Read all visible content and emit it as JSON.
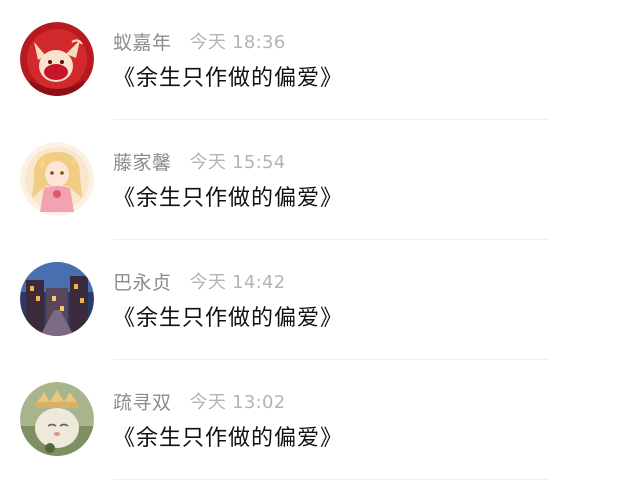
{
  "comments": [
    {
      "avatar_icon": "red-fox-avatar-icon",
      "name": "蚁嘉年",
      "time": "今天 18:36",
      "message": "《余生只作做的偏爱》"
    },
    {
      "avatar_icon": "golden-girl-avatar-icon",
      "name": "藤家馨",
      "time": "今天 15:54",
      "message": "《余生只作做的偏爱》"
    },
    {
      "avatar_icon": "night-street-avatar-icon",
      "name": "巴永贞",
      "time": "今天 14:42",
      "message": "《余生只作做的偏爱》"
    },
    {
      "avatar_icon": "cat-with-crown-avatar-icon",
      "name": "疏寻双",
      "time": "今天 13:02",
      "message": "《余生只作做的偏爱》"
    }
  ]
}
